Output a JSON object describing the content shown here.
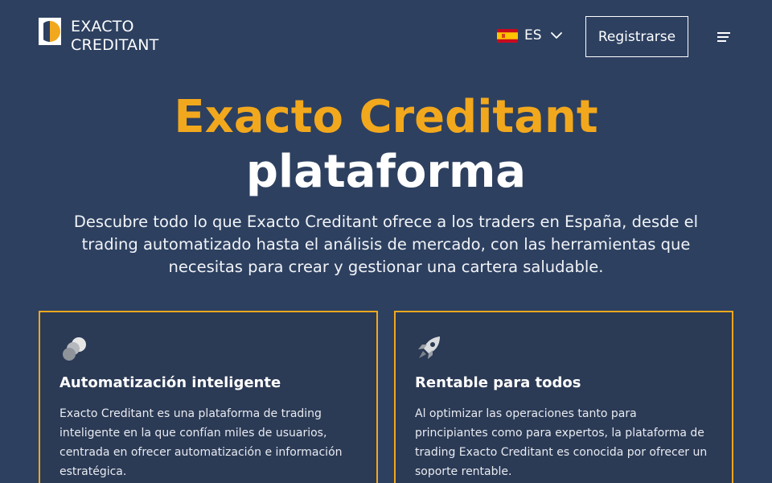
{
  "header": {
    "logo": {
      "line1": "EXACTO",
      "line2": "CREDITANT"
    },
    "language": {
      "code": "ES",
      "flag_icon": "spain-flag-icon"
    },
    "register_label": "Registrarse",
    "menu_icon": "hamburger-menu-icon"
  },
  "hero": {
    "title_accent": "Exacto Creditant",
    "title_rest": "plataforma",
    "description": "Descubre todo lo que Exacto Creditant ofrece a los traders en España, desde el trading automatizado hasta el análisis de mercado, con las herramientas que necesitas para crear y gestionar una cartera saludable."
  },
  "cards": [
    {
      "icon": "automation-icon",
      "title": "Automatización inteligente",
      "text": "Exacto Creditant es una plataforma de trading inteligente en la que confían miles de usuarios, centrada en ofrecer automatización e información estratégica."
    },
    {
      "icon": "rocket-icon",
      "title": "Rentable para todos",
      "text": "Al optimizar las operaciones tanto para principiantes como para expertos, la plataforma de trading Exacto Creditant es conocida por ofrecer un soporte rentable."
    }
  ],
  "colors": {
    "background": "#2d4060",
    "accent": "#f2a81d",
    "card_background": "#2b3a55"
  }
}
